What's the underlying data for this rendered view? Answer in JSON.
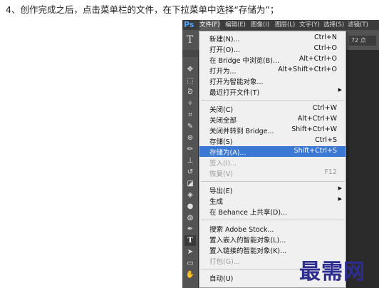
{
  "caption": "4、创作完成之后，点击菜单栏的文件，在下拉菜单中选择“存储为”；",
  "app": {
    "logo": "Ps",
    "menubar": [
      "文件(F)",
      "编辑(E)",
      "图像(I)",
      "图层(L)",
      "文字(Y)",
      "选择(S)",
      "滤镜(T)"
    ],
    "options_text_tool": "T",
    "options_size_value": "72 点"
  },
  "tools": [
    "move-icon",
    "marquee-icon",
    "lasso-icon",
    "magic-wand-icon",
    "crop-icon",
    "eyedropper-icon",
    "healing-brush-icon",
    "brush-icon",
    "clone-stamp-icon",
    "history-brush-icon",
    "eraser-icon",
    "paint-bucket-icon",
    "blur-icon",
    "dodge-icon",
    "pen-icon",
    "type-icon",
    "path-selection-icon",
    "rectangle-icon",
    "hand-icon"
  ],
  "file_menu": {
    "items": [
      {
        "label": "新建(N)...",
        "shortcut": "Ctrl+N"
      },
      {
        "label": "打开(O)...",
        "shortcut": "Ctrl+O"
      },
      {
        "label": "在 Bridge 中浏览(B)...",
        "shortcut": "Alt+Ctrl+O"
      },
      {
        "label": "打开为...",
        "shortcut": "Alt+Shift+Ctrl+O"
      },
      {
        "label": "打开为智能对象...",
        "shortcut": ""
      },
      {
        "label": "最近打开文件(T)",
        "shortcut": "",
        "submenu": true
      },
      {
        "label": "关闭(C)",
        "shortcut": "Ctrl+W"
      },
      {
        "label": "关闭全部",
        "shortcut": "Alt+Ctrl+W"
      },
      {
        "label": "关闭并转到 Bridge...",
        "shortcut": "Shift+Ctrl+W"
      },
      {
        "label": "存储(S)",
        "shortcut": "Ctrl+S"
      },
      {
        "label": "存储为(A)...",
        "shortcut": "Shift+Ctrl+S",
        "highlighted": true
      },
      {
        "label": "签入(I)...",
        "shortcut": "",
        "disabled": true
      },
      {
        "label": "恢复(V)",
        "shortcut": "F12",
        "disabled": true
      },
      {
        "label": "导出(E)",
        "shortcut": "",
        "submenu": true
      },
      {
        "label": "生成",
        "shortcut": "",
        "submenu": true
      },
      {
        "label": "在 Behance 上共享(D)...",
        "shortcut": ""
      },
      {
        "label": "搜索 Adobe Stock...",
        "shortcut": ""
      },
      {
        "label": "置入嵌入的智能对象(L)...",
        "shortcut": ""
      },
      {
        "label": "置入链接的智能对象(K)...",
        "shortcut": ""
      },
      {
        "label": "打包(G)...",
        "shortcut": "",
        "disabled": true
      },
      {
        "label": "自动(U)",
        "shortcut": "",
        "submenu": true
      }
    ]
  },
  "watermark": "最需网",
  "colors": {
    "highlight": "#3a78d4",
    "menu_bg": "#f0f0f0",
    "ps_dark": "#474747",
    "watermark": "#2d2d8f"
  }
}
